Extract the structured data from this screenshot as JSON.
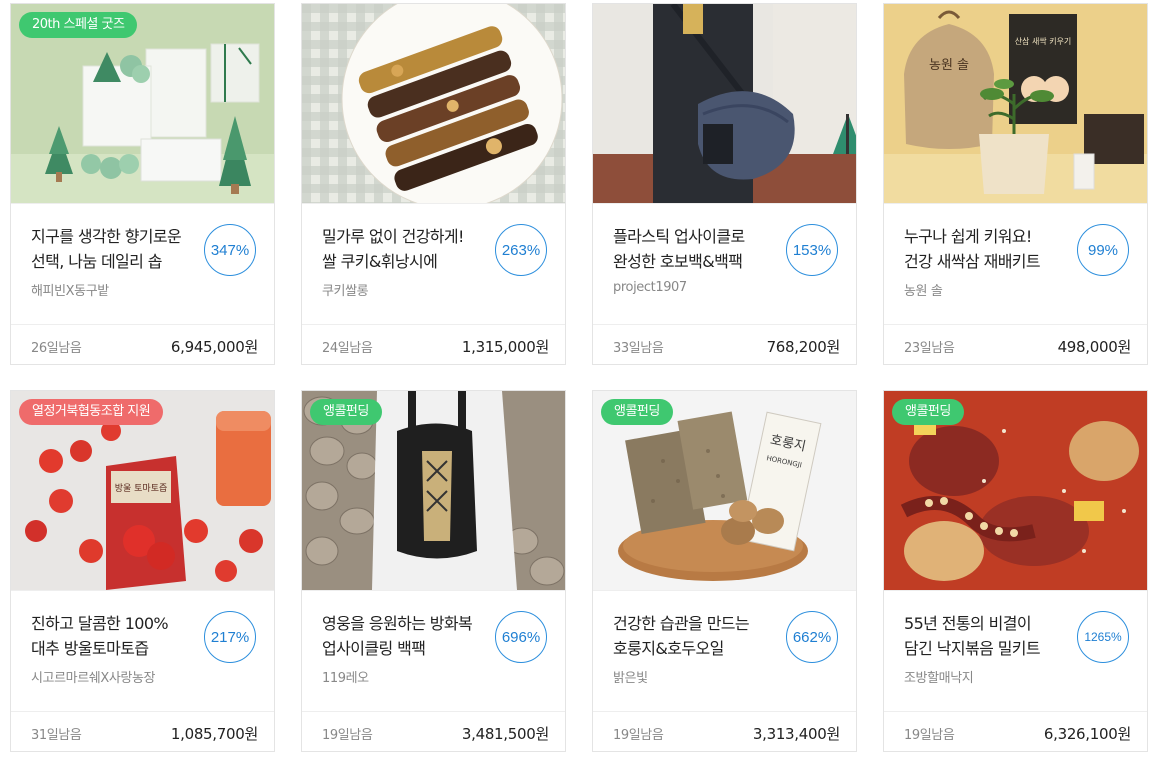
{
  "cards": [
    {
      "badge": "20th 스페셜 굿즈",
      "badge_color": "#3fc870",
      "title_l1": "지구를 생각한 향기로운",
      "title_l2": "선택, 나눔 데일리 솝",
      "maker": "해피빈X동구밭",
      "rate": "347%",
      "days": "26일남음",
      "amount": "6,945,000원"
    },
    {
      "badge": "",
      "title_l1": "밀가루 없이 건강하게!",
      "title_l2": "쌀 쿠키&휘낭시에",
      "maker": "쿠키쌀롱",
      "rate": "263%",
      "days": "24일남음",
      "amount": "1,315,000원"
    },
    {
      "badge": "",
      "title_l1": "플라스틱 업사이클로",
      "title_l2": "완성한 호보백&백팩",
      "maker": "project1907",
      "rate": "153%",
      "days": "33일남음",
      "amount": "768,200원"
    },
    {
      "badge": "",
      "title_l1": "누구나 쉽게 키워요!",
      "title_l2": "건강 새싹삼 재배키트",
      "maker": "농원 솔",
      "rate": "99%",
      "days": "23일남음",
      "amount": "498,000원"
    },
    {
      "badge": "열정거북협동조합 지원",
      "badge_color": "#ef6b6b",
      "title_l1": "진하고 달콤한 100%",
      "title_l2": "대추 방울토마토즙",
      "maker": "시고르마르쉐X사랑농장",
      "rate": "217%",
      "days": "31일남음",
      "amount": "1,085,700원"
    },
    {
      "badge": "앵콜펀딩",
      "badge_color": "#3fc870",
      "title_l1": "영웅을 응원하는 방화복",
      "title_l2": "업사이클링 백팩",
      "maker": "119레오",
      "rate": "696%",
      "days": "19일남음",
      "amount": "3,481,500원"
    },
    {
      "badge": "앵콜펀딩",
      "badge_color": "#3fc870",
      "title_l1": "건강한 습관을 만드는",
      "title_l2": "호룽지&호두오일",
      "maker": "밝은빛",
      "rate": "662%",
      "days": "19일남음",
      "amount": "3,313,400원"
    },
    {
      "badge": "앵콜펀딩",
      "badge_color": "#3fc870",
      "title_l1": "55년 전통의 비결이",
      "title_l2": "담긴 낙지볶음 밀키트",
      "maker": "조방할매낙지",
      "rate": "1265%",
      "days": "19일남음",
      "amount": "6,326,100원"
    }
  ],
  "image_text": {
    "soil_box": "농원 솔",
    "book": "산삼 새싹 키우기",
    "tomato_pack": "방울 토마토즙",
    "cracker_pack": "호룽지",
    "cracker_pack_en": "HORONGJI"
  },
  "colors": {
    "accent_blue": "#1f7fd2",
    "badge_green": "#3fc870",
    "badge_red": "#ef6b6b"
  }
}
